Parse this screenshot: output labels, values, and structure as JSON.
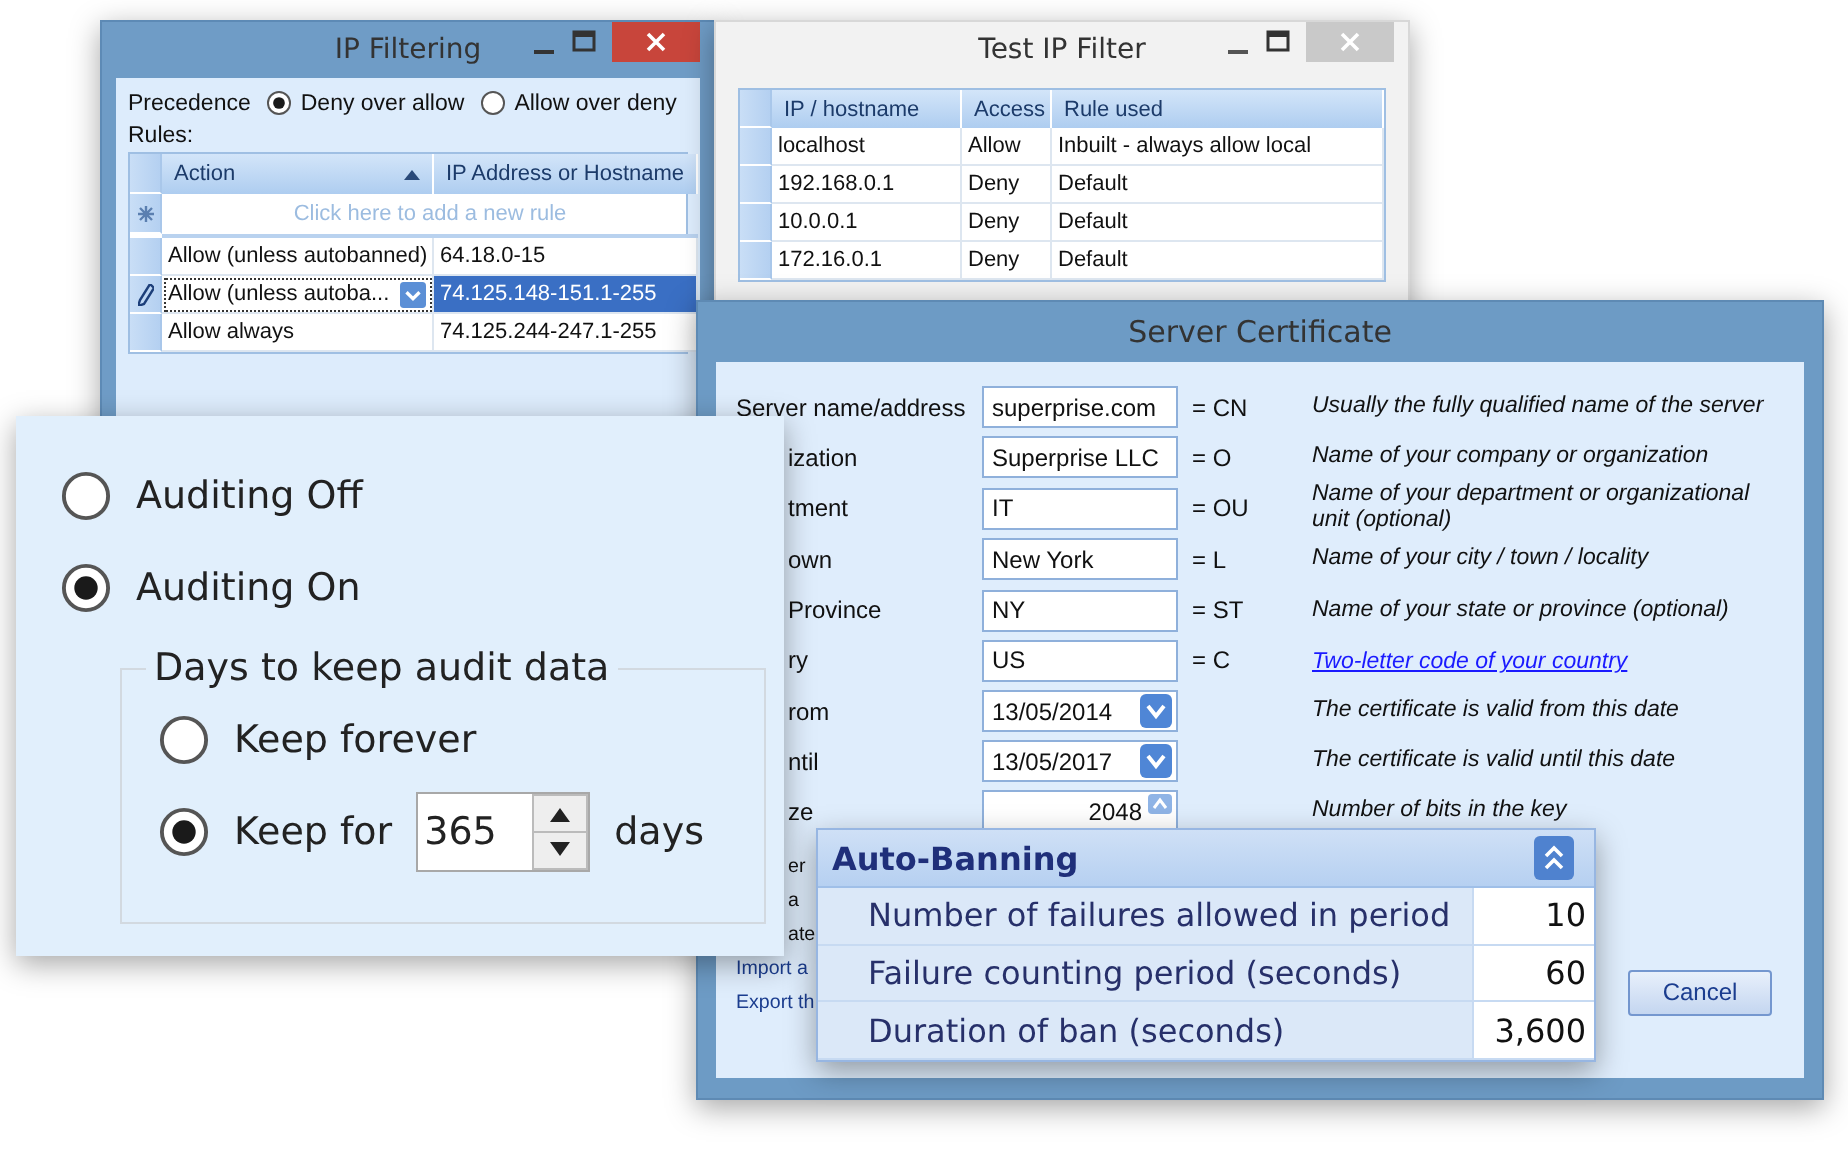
{
  "ip_filtering": {
    "title": "IP Filtering",
    "precedence": {
      "label": "Precedence",
      "options": [
        {
          "label": "Deny over allow",
          "selected": true
        },
        {
          "label": "Allow over deny",
          "selected": false
        }
      ]
    },
    "rules_label": "Rules:",
    "columns": [
      {
        "label": "Action",
        "sorted": true
      },
      {
        "label": "IP Address or Hostname",
        "sorted": false
      }
    ],
    "new_row_hint": "Click here to add a new rule",
    "rows": [
      {
        "action": "Allow (unless autobanned)",
        "address": "64.18.0-15",
        "selected": false,
        "editing": false
      },
      {
        "action": "Allow (unless autoba...",
        "address": "74.125.148-151.1-255",
        "selected": true,
        "editing": true
      },
      {
        "action": "Allow always",
        "address": "74.125.244-247.1-255",
        "selected": false,
        "editing": false
      }
    ]
  },
  "test_ip_filter": {
    "title": "Test IP Filter",
    "columns": [
      "IP / hostname",
      "Access",
      "Rule used"
    ],
    "rows": [
      [
        "localhost",
        "Allow",
        "Inbuilt - always allow local"
      ],
      [
        "192.168.0.1",
        "Deny",
        "Default"
      ],
      [
        "10.0.0.1",
        "Deny",
        "Default"
      ],
      [
        "172.16.0.1",
        "Deny",
        "Default"
      ]
    ]
  },
  "server_certificate": {
    "title": "Server Certificate",
    "rows": [
      {
        "label": "Server name/address",
        "label_cut": false,
        "kind": "input",
        "value": "superprise.com",
        "code": "= CN",
        "hint": "Usually the fully qualified name of the server",
        "link": false
      },
      {
        "label": "ization",
        "label_cut": true,
        "kind": "input",
        "value": "Superprise LLC",
        "code": "= O",
        "hint": "Name of your company or organization",
        "link": false
      },
      {
        "label": "tment",
        "label_cut": true,
        "kind": "input",
        "value": "IT",
        "code": "= OU",
        "hint": "Name of your department or organizational unit (optional)",
        "link": false
      },
      {
        "label": "own",
        "label_cut": true,
        "kind": "input",
        "value": "New York",
        "code": "= L",
        "hint": "Name of your city / town / locality",
        "link": false
      },
      {
        "label": "Province",
        "label_cut": true,
        "kind": "input",
        "value": "NY",
        "code": "= ST",
        "hint": "Name of your state or province (optional)",
        "link": false
      },
      {
        "label": "ry",
        "label_cut": true,
        "kind": "input",
        "value": "US",
        "code": "= C",
        "hint": "Two-letter code of your country",
        "link": true
      },
      {
        "label": "rom",
        "label_cut": true,
        "kind": "date",
        "value": "13/05/2014",
        "hint": "The certificate is valid from this date",
        "link": false
      },
      {
        "label": "ntil",
        "label_cut": true,
        "kind": "date",
        "value": "13/05/2017",
        "hint": "The certificate is valid until this date",
        "link": false
      },
      {
        "label": "ze",
        "label_cut": true,
        "kind": "spin",
        "value": "2048",
        "hint": "Number of bits in the key",
        "link": false
      }
    ],
    "lower_items": [
      {
        "text": "er",
        "link": false
      },
      {
        "text": "a",
        "link": false
      },
      {
        "text": "ate",
        "link": false
      },
      {
        "text": "Import a",
        "link": true
      },
      {
        "text": "Export th",
        "link": true
      }
    ],
    "cancel_button": "Cancel"
  },
  "auditing": {
    "options": [
      {
        "label": "Auditing Off",
        "selected": false
      },
      {
        "label": "Auditing On",
        "selected": true
      }
    ],
    "group": {
      "legend": "Days to keep audit data",
      "options": [
        {
          "label": "Keep forever",
          "selected": false
        },
        {
          "label": "Keep for",
          "selected": true,
          "value": "365",
          "unit": "days"
        }
      ]
    }
  },
  "auto_banning": {
    "title": "Auto-Banning",
    "rows": [
      {
        "label": "Number of failures allowed in period",
        "value": "10"
      },
      {
        "label": "Failure counting period (seconds)",
        "value": "60"
      },
      {
        "label": "Duration of ban (seconds)",
        "value": "3,600"
      }
    ]
  }
}
